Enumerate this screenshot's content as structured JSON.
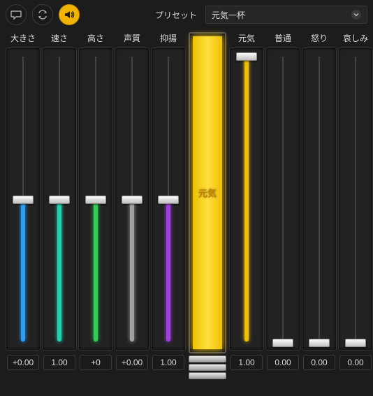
{
  "topbar": {
    "preset_label": "プリセット",
    "preset_value": "元気一杯"
  },
  "icons": {
    "speech": "speech-bubble-icon",
    "loop": "loop-icon",
    "speaker": "speaker-icon"
  },
  "left_sliders": [
    {
      "label": "大きさ",
      "value_text": "+0.00",
      "pos": 0.5,
      "direction": "center",
      "color": "#2e9df4"
    },
    {
      "label": "速さ",
      "value_text": "1.00",
      "pos": 0.5,
      "direction": "center",
      "color": "#1fd1b1"
    },
    {
      "label": "高さ",
      "value_text": "+0",
      "pos": 0.5,
      "direction": "center",
      "color": "#2fcf56"
    },
    {
      "label": "声質",
      "value_text": "+0.00",
      "pos": 0.5,
      "direction": "center",
      "color": "#a0a0a0"
    },
    {
      "label": "抑揚",
      "value_text": "1.00",
      "pos": 0.5,
      "direction": "center",
      "color": "#a040e0"
    }
  ],
  "meter": {
    "label": "元気"
  },
  "right_sliders": [
    {
      "label": "元気",
      "value_text": "1.00",
      "pos": 1.0,
      "direction": "bottom",
      "color": "#f0c000"
    },
    {
      "label": "普通",
      "value_text": "0.00",
      "pos": 0.0,
      "direction": "bottom",
      "color": "#888888"
    },
    {
      "label": "怒り",
      "value_text": "0.00",
      "pos": 0.0,
      "direction": "bottom",
      "color": "#888888"
    },
    {
      "label": "哀しみ",
      "value_text": "0.00",
      "pos": 0.0,
      "direction": "bottom",
      "color": "#888888"
    }
  ],
  "colors": {
    "accent": "#f0b400"
  }
}
